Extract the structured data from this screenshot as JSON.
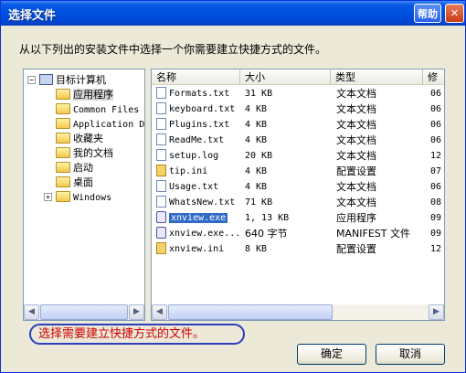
{
  "window": {
    "title": "选择文件",
    "help_label": "帮助",
    "close_label": "✕"
  },
  "instruction": "从以下列出的安装文件中选择一个你需要建立快捷方式的文件。",
  "tree": {
    "root_label": "目标计算机",
    "items": [
      {
        "label": "应用程序",
        "selected": true
      },
      {
        "label": "Common Files"
      },
      {
        "label": "Application D"
      },
      {
        "label": "收藏夹"
      },
      {
        "label": "我的文档"
      },
      {
        "label": "启动"
      },
      {
        "label": "桌面"
      },
      {
        "label": "Windows",
        "expandable": true
      }
    ]
  },
  "list": {
    "columns": [
      "名称",
      "大小",
      "类型",
      "修"
    ],
    "rows": [
      {
        "name": "Formats.txt",
        "size": "31 KB",
        "type": "文本文档",
        "modified": "06",
        "icon": "text-file-icon"
      },
      {
        "name": "keyboard.txt",
        "size": "4 KB",
        "type": "文本文档",
        "modified": "06",
        "icon": "text-file-icon"
      },
      {
        "name": "Plugins.txt",
        "size": "4 KB",
        "type": "文本文档",
        "modified": "06",
        "icon": "text-file-icon"
      },
      {
        "name": "ReadMe.txt",
        "size": "4 KB",
        "type": "文本文档",
        "modified": "06",
        "icon": "text-file-icon"
      },
      {
        "name": "setup.log",
        "size": "20 KB",
        "type": "文本文档",
        "modified": "12",
        "icon": "text-file-icon"
      },
      {
        "name": "tip.ini",
        "size": "4 KB",
        "type": "配置设置",
        "modified": "07",
        "icon": "config-file-icon"
      },
      {
        "name": "Usage.txt",
        "size": "4 KB",
        "type": "文本文档",
        "modified": "06",
        "icon": "text-file-icon"
      },
      {
        "name": "WhatsNew.txt",
        "size": "71 KB",
        "type": "文本文档",
        "modified": "08",
        "icon": "text-file-icon"
      },
      {
        "name": "xnview.exe",
        "size": "1, 13 KB",
        "type": "应用程序",
        "modified": "09",
        "icon": "exe-file-icon",
        "selected": true
      },
      {
        "name": "xnview.exe...",
        "size": "640 字节",
        "type": "MANIFEST 文件",
        "modified": "09",
        "icon": "manifest-file-icon"
      },
      {
        "name": "xnview.ini",
        "size": "8 KB",
        "type": "配置设置",
        "modified": "12",
        "icon": "config-file-icon"
      }
    ]
  },
  "hint": "选择需要建立快捷方式的文件。",
  "buttons": {
    "ok": "确定",
    "cancel": "取消"
  },
  "colors": {
    "title_bar": "#0050e0",
    "selection": "#316ac5",
    "hint_text": "#d00000",
    "hint_border": "#2b3fbf"
  }
}
